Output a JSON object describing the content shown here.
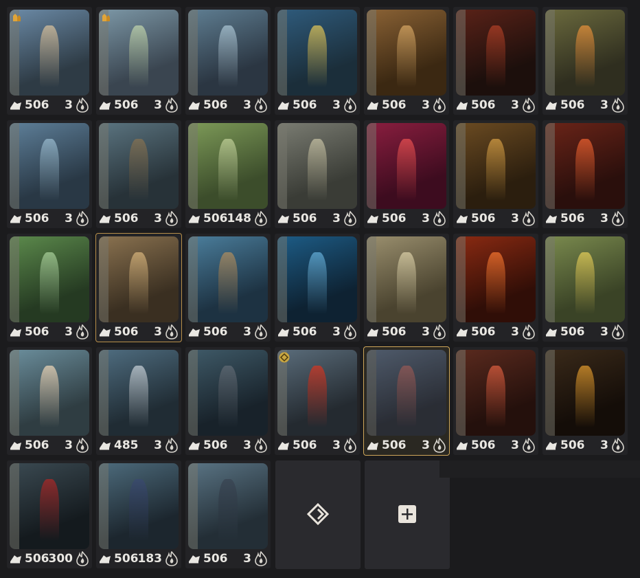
{
  "characters": [
    {
      "id": "c1",
      "level": "506",
      "count": "3",
      "art": [
        "#6b8aa6",
        "#2e3b45",
        "#c8b79a"
      ],
      "badge": "character-type-icon"
    },
    {
      "id": "c2",
      "level": "506",
      "count": "3",
      "art": [
        "#7c97a6",
        "#3a4550",
        "#b5c9a8"
      ],
      "badge": "character-type-icon"
    },
    {
      "id": "c3",
      "level": "506",
      "count": "3",
      "art": [
        "#5f7e92",
        "#2b3642",
        "#9fb9c8"
      ]
    },
    {
      "id": "c4",
      "level": "506",
      "count": "3",
      "art": [
        "#2f5b7c",
        "#1b2e3a",
        "#c9b65a"
      ]
    },
    {
      "id": "c5",
      "level": "506",
      "count": "3",
      "art": [
        "#8a6235",
        "#3b2812",
        "#c99b5c"
      ]
    },
    {
      "id": "c6",
      "level": "506",
      "count": "3",
      "art": [
        "#5a2218",
        "#1c0f0c",
        "#a23b24"
      ]
    },
    {
      "id": "c7",
      "level": "506",
      "count": "3",
      "art": [
        "#6b6a3e",
        "#2f2e1f",
        "#d58a3a"
      ]
    },
    {
      "id": "c8",
      "level": "506",
      "count": "3",
      "art": [
        "#5e7f99",
        "#293845",
        "#8fb0c4"
      ]
    },
    {
      "id": "c9",
      "level": "506",
      "count": "3",
      "art": [
        "#5b7480",
        "#273238",
        "#7e6f54"
      ]
    },
    {
      "id": "c10",
      "level": "506",
      "count": "148",
      "art": [
        "#7d9a58",
        "#3c4d2b",
        "#b5c68e"
      ]
    },
    {
      "id": "c11",
      "level": "506",
      "count": "3",
      "art": [
        "#7a7c72",
        "#3a3c36",
        "#b9b59a"
      ]
    },
    {
      "id": "c12",
      "level": "506",
      "count": "3",
      "art": [
        "#8a1e3f",
        "#3d0c1f",
        "#d9484d"
      ]
    },
    {
      "id": "c13",
      "level": "506",
      "count": "3",
      "art": [
        "#6b4b22",
        "#2b1e0e",
        "#c4913f"
      ]
    },
    {
      "id": "c14",
      "level": "506",
      "count": "3",
      "art": [
        "#6a2418",
        "#2a0f0c",
        "#d8582c"
      ]
    },
    {
      "id": "c15",
      "level": "506",
      "count": "3",
      "art": [
        "#5c8a4c",
        "#253a22",
        "#9cc38e"
      ]
    },
    {
      "id": "c16",
      "level": "506",
      "count": "3",
      "art": [
        "#8a7250",
        "#3a2f21",
        "#c9a874"
      ],
      "selected": true
    },
    {
      "id": "c17",
      "level": "506",
      "count": "3",
      "art": [
        "#4b7e9c",
        "#1d3242",
        "#a08863"
      ]
    },
    {
      "id": "c18",
      "level": "506",
      "count": "3",
      "art": [
        "#1d5c86",
        "#0e2232",
        "#5aa0c9"
      ]
    },
    {
      "id": "c19",
      "level": "506",
      "count": "3",
      "art": [
        "#9a8f6e",
        "#4a432f",
        "#cfc49d"
      ]
    },
    {
      "id": "c20",
      "level": "506",
      "count": "3",
      "art": [
        "#8a2a12",
        "#300e07",
        "#e2692a"
      ]
    },
    {
      "id": "c21",
      "level": "506",
      "count": "3",
      "art": [
        "#7a8a4e",
        "#3a4326",
        "#d3c155"
      ]
    },
    {
      "id": "c22",
      "level": "506",
      "count": "3",
      "art": [
        "#6b8e9c",
        "#2f3d42",
        "#d9c9b0"
      ]
    },
    {
      "id": "c23",
      "level": "485",
      "count": "3",
      "art": [
        "#4f6d80",
        "#202c34",
        "#b5c0c8"
      ]
    },
    {
      "id": "c24",
      "level": "506",
      "count": "3",
      "art": [
        "#3f5a68",
        "#18222a",
        "#5b6670"
      ]
    },
    {
      "id": "c25",
      "level": "506",
      "count": "3",
      "art": [
        "#5a6c7a",
        "#242a30",
        "#c03a2a"
      ],
      "badge": "rarity-diamond-icon"
    },
    {
      "id": "c26",
      "level": "506",
      "count": "3",
      "art": [
        "#5e6f88",
        "#2a2f3c",
        "#b06a6a"
      ],
      "selected": true,
      "dim": true
    },
    {
      "id": "c27",
      "level": "506",
      "count": "3",
      "art": [
        "#5a2a1e",
        "#24100c",
        "#c8563a"
      ]
    },
    {
      "id": "c28",
      "level": "506",
      "count": "3",
      "art": [
        "#3a2a1a",
        "#140d08",
        "#c98a2a"
      ]
    },
    {
      "id": "c29",
      "level": "506",
      "count": "300",
      "art": [
        "#3b4a52",
        "#141a1e",
        "#9a2a2a"
      ]
    },
    {
      "id": "c30",
      "level": "506",
      "count": "183",
      "art": [
        "#4d6b7c",
        "#1c262e",
        "#3a4a6e"
      ]
    },
    {
      "id": "c31",
      "level": "506",
      "count": "3",
      "art": [
        "#5a7484",
        "#232e36",
        "#3a4654"
      ]
    }
  ],
  "empty_slots": [
    {
      "id": "sort",
      "icon": "rotate-diamond-icon"
    },
    {
      "id": "add",
      "icon": "plus-square-icon"
    }
  ],
  "colors": {
    "card_bg": "#232326",
    "selected_outline": "#b9904a",
    "text": "#e9e7e2"
  }
}
